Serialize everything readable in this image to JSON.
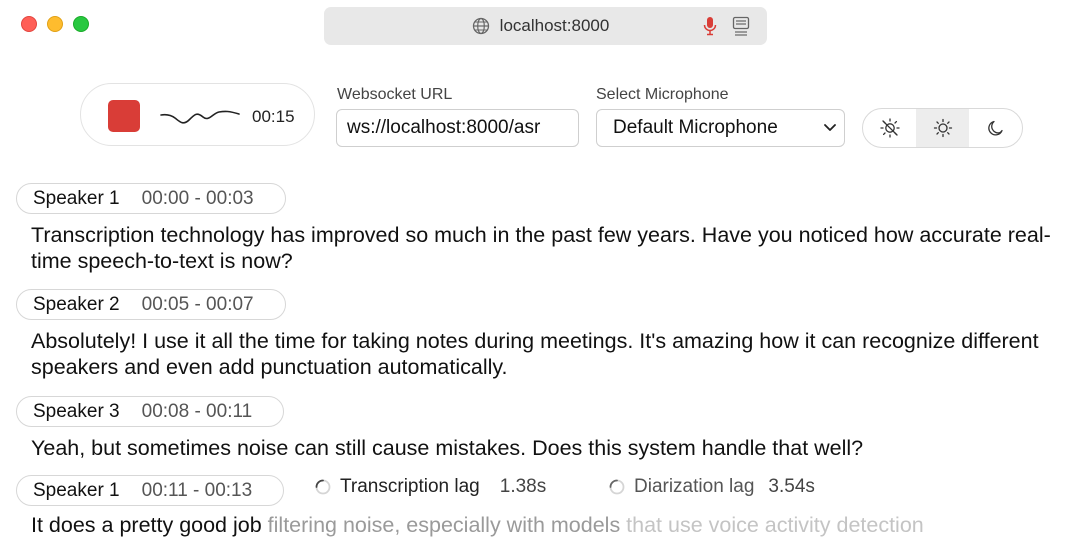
{
  "browser": {
    "url": "localhost:8000"
  },
  "recorder": {
    "timer": "00:15",
    "recording_color": "#d93d37"
  },
  "websocket": {
    "label": "Websocket URL",
    "value": "ws://localhost:8000/asr"
  },
  "microphone": {
    "label": "Select Microphone",
    "selected": "Default Microphone"
  },
  "theme": {
    "options": [
      "system-icon",
      "sun-icon",
      "moon-icon"
    ],
    "active": "sun-icon"
  },
  "transcript": {
    "segments": [
      {
        "speaker": "Speaker 1",
        "time": "00:00 - 00:03",
        "text": "Transcription technology has improved so much in the past few years. Have you noticed how accurate real-time speech-to-text is now?"
      },
      {
        "speaker": "Speaker 2",
        "time": "00:05 - 00:07",
        "text": "Absolutely! I use it all the time for taking notes during meetings. It's amazing how it can recognize different speakers and even add punctuation automatically."
      },
      {
        "speaker": "Speaker 3",
        "time": "00:08 - 00:11",
        "text": "Yeah, but sometimes noise can still cause mistakes. Does this system handle that well?"
      },
      {
        "speaker": "Speaker 1",
        "time": "00:11 - 00:13",
        "text_final": "It does a pretty good job ",
        "text_buffer1": "filtering noise, especially with models ",
        "text_buffer2": "that use voice activity detection"
      }
    ],
    "transcription_lag": {
      "label": "Transcription lag",
      "value": "1.38s"
    },
    "diarization_lag": {
      "label": "Diarization lag",
      "value": "3.54s"
    }
  }
}
